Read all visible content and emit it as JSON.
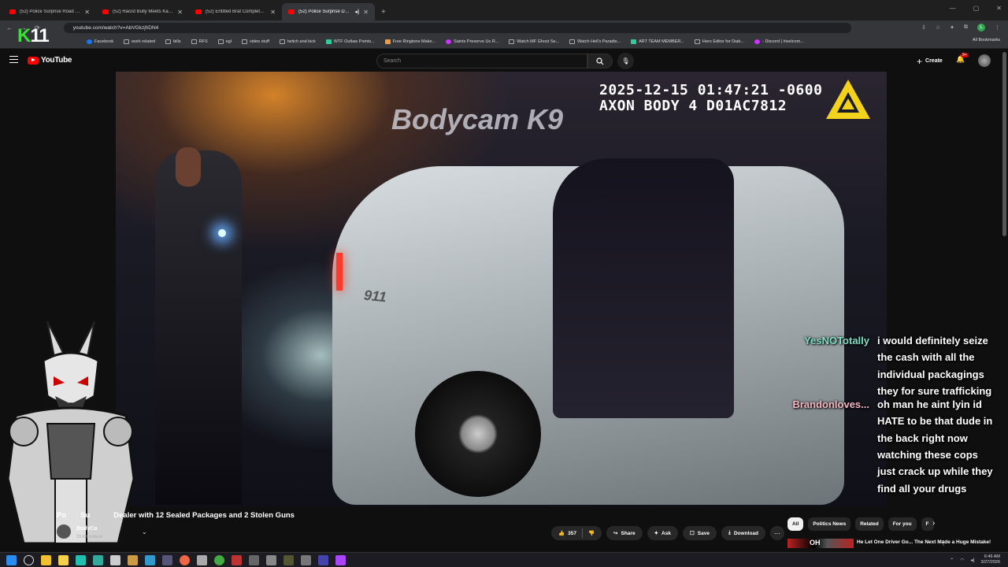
{
  "browser": {
    "tabs": [
      {
        "label": "(52) Police Surprise Road Rage"
      },
      {
        "label": "(52) Racist Bully Meets Karma"
      },
      {
        "label": "(52) Entitled Brat Completely L"
      },
      {
        "label": "(52) Police Surprise Drug D",
        "active": true
      }
    ],
    "url": "youtube.com/watch?v=AbVGkzjhDN4",
    "bookmarks": [
      {
        "label": "Facebook",
        "icon": "facebook-icon"
      },
      {
        "label": "work related",
        "icon": "folder-icon"
      },
      {
        "label": "bills",
        "icon": "folder-icon"
      },
      {
        "label": "RFS",
        "icon": "folder-icon"
      },
      {
        "label": "egl",
        "icon": "folder-icon"
      },
      {
        "label": "video stuff",
        "icon": "folder-icon"
      },
      {
        "label": "twitch and kick",
        "icon": "folder-icon"
      },
      {
        "label": "WTF Outlaw Points...",
        "icon": "site-icon"
      },
      {
        "label": "Free Ringtone Make...",
        "icon": "site-icon"
      },
      {
        "label": "Saints Preserve Us R...",
        "icon": "site-icon"
      },
      {
        "label": "Watch MF Ghost Se...",
        "icon": "site-icon"
      },
      {
        "label": "Watch Hell's Paradis...",
        "icon": "site-icon"
      },
      {
        "label": "ART TEAM MEMBER...",
        "icon": "site-icon"
      },
      {
        "label": "Hero Editor for Diab...",
        "icon": "site-icon"
      },
      {
        "label": "- Discord | #welcom...",
        "icon": "discord-icon"
      }
    ],
    "all_bookmarks": "All Bookmarks"
  },
  "overlay": {
    "logo_k": "K",
    "logo_num": "11"
  },
  "youtube": {
    "brand": "YouTube",
    "search_placeholder": "Search",
    "create_label": "Create",
    "notif_badge": "9+"
  },
  "video": {
    "watermark": "Bodycam K9",
    "timestamp": "2025-12-15 01:47:21 -0600",
    "device": "AXON BODY 4 D01AC7812",
    "car_number": "911"
  },
  "chat": [
    {
      "user": "YesNOTotally",
      "color": "#7fe0c4",
      "text": "i would definitely seize the cash with all the individual packagings they for sure trafficking"
    },
    {
      "user": "Brandonloves...",
      "color": "#f4b6c2",
      "text": "oh man he aint lyin id HATE to be that dude in the back right now watching these cops just crack up while they find all your drugs"
    }
  ],
  "info": {
    "title_lead": "Po",
    "title_mid": "Su",
    "title_rest": "Dealer with 12 Sealed Packages and 2 Stolen Guns",
    "channel_name": "BodyCa",
    "channel_subs": "23.6K subscri",
    "likes": "357",
    "share": "Share",
    "ask": "Ask",
    "save": "Save",
    "download": "Download"
  },
  "chips": [
    "All",
    "Politics News",
    "Related",
    "For you",
    "F"
  ],
  "recommendation": {
    "thumb_text": "OH",
    "title": "He Let One Driver Go... The Next Made a Huge Mistake!"
  },
  "taskbar": {
    "time": "6:46 AM",
    "date": "3/27/2026"
  },
  "colors": {
    "yt_red": "#ff0000",
    "accent_green": "#38e038"
  }
}
